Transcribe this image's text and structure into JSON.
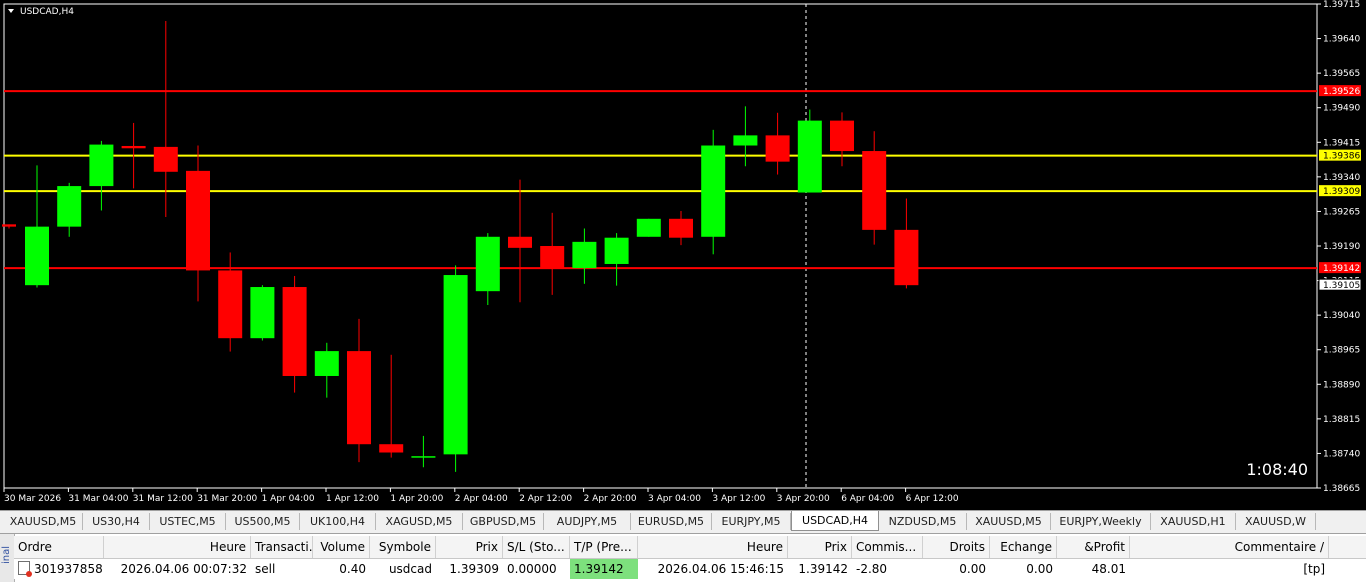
{
  "chart": {
    "title": "USDCAD,H4",
    "timer": "1:08:40",
    "colors": {
      "bull": "#00ff00",
      "bear": "#ff0000",
      "bg": "#000000",
      "grid_line": "#ffffff",
      "red_line": "#ff0000",
      "yellow_line": "#ffff00"
    },
    "price_ticks": [
      "1.39715",
      "1.39640",
      "1.39565",
      "1.39490",
      "1.39415",
      "1.39340",
      "1.39265",
      "1.39190",
      "1.39115",
      "1.39040",
      "1.38965",
      "1.38890",
      "1.38815",
      "1.38740",
      "1.38665"
    ],
    "time_labels": [
      "30 Mar 2026",
      "31 Mar 04:00",
      "31 Mar 12:00",
      "31 Mar 20:00",
      "1 Apr 04:00",
      "1 Apr 12:00",
      "1 Apr 20:00",
      "2 Apr 04:00",
      "2 Apr 12:00",
      "2 Apr 20:00",
      "3 Apr 04:00",
      "3 Apr 12:00",
      "3 Apr 20:00",
      "6 Apr 04:00",
      "6 Apr 12:00"
    ],
    "levels": [
      {
        "price": 1.39526,
        "label": "1.39526",
        "type": "red"
      },
      {
        "price": 1.39386,
        "label": "1.39386",
        "type": "yellow"
      },
      {
        "price": 1.39309,
        "label": "1.39309",
        "type": "yellow"
      },
      {
        "price": 1.39142,
        "label": "1.39142",
        "type": "red"
      }
    ],
    "current_price": {
      "price": 1.39105,
      "label": "1.39105"
    }
  },
  "chart_data": {
    "type": "candlestick",
    "symbol": "USDCAD",
    "timeframe": "H4",
    "ylim": [
      1.38665,
      1.39715
    ],
    "candles": [
      {
        "o": 1.39237,
        "h": 1.39237,
        "l": 1.39228,
        "c": 1.39232
      },
      {
        "o": 1.39105,
        "h": 1.39365,
        "l": 1.391,
        "c": 1.39232
      },
      {
        "o": 1.39232,
        "h": 1.39327,
        "l": 1.3921,
        "c": 1.3932
      },
      {
        "o": 1.3932,
        "h": 1.39418,
        "l": 1.39267,
        "c": 1.3941
      },
      {
        "o": 1.39407,
        "h": 1.39457,
        "l": 1.39315,
        "c": 1.39402
      },
      {
        "o": 1.39405,
        "h": 1.39678,
        "l": 1.39253,
        "c": 1.39351
      },
      {
        "o": 1.39353,
        "h": 1.39408,
        "l": 1.3907,
        "c": 1.39137
      },
      {
        "o": 1.39137,
        "h": 1.39176,
        "l": 1.38961,
        "c": 1.3899
      },
      {
        "o": 1.3899,
        "h": 1.39105,
        "l": 1.38985,
        "c": 1.39101
      },
      {
        "o": 1.39101,
        "h": 1.39125,
        "l": 1.38872,
        "c": 1.38908
      },
      {
        "o": 1.38908,
        "h": 1.3898,
        "l": 1.38861,
        "c": 1.38962
      },
      {
        "o": 1.38962,
        "h": 1.39032,
        "l": 1.38721,
        "c": 1.3876
      },
      {
        "o": 1.3876,
        "h": 1.38954,
        "l": 1.38731,
        "c": 1.38742
      },
      {
        "o": 1.38734,
        "h": 1.38778,
        "l": 1.3871,
        "c": 1.38734
      },
      {
        "o": 1.38738,
        "h": 1.39148,
        "l": 1.387,
        "c": 1.39127
      },
      {
        "o": 1.39092,
        "h": 1.39218,
        "l": 1.39062,
        "c": 1.3921
      },
      {
        "o": 1.3921,
        "h": 1.39334,
        "l": 1.39068,
        "c": 1.39186
      },
      {
        "o": 1.3919,
        "h": 1.39262,
        "l": 1.39084,
        "c": 1.3914
      },
      {
        "o": 1.39142,
        "h": 1.39228,
        "l": 1.39108,
        "c": 1.39199
      },
      {
        "o": 1.39151,
        "h": 1.39218,
        "l": 1.39104,
        "c": 1.39208
      },
      {
        "o": 1.3921,
        "h": 1.39249,
        "l": 1.3921,
        "c": 1.39249
      },
      {
        "o": 1.39249,
        "h": 1.39266,
        "l": 1.39192,
        "c": 1.39208
      },
      {
        "o": 1.3921,
        "h": 1.39442,
        "l": 1.39172,
        "c": 1.39408
      },
      {
        "o": 1.39408,
        "h": 1.39493,
        "l": 1.39363,
        "c": 1.3943
      },
      {
        "o": 1.3943,
        "h": 1.39479,
        "l": 1.39345,
        "c": 1.39373
      },
      {
        "o": 1.39306,
        "h": 1.39486,
        "l": 1.39306,
        "c": 1.39462
      },
      {
        "o": 1.39462,
        "h": 1.3948,
        "l": 1.39363,
        "c": 1.39396
      },
      {
        "o": 1.39396,
        "h": 1.39439,
        "l": 1.39193,
        "c": 1.39225
      },
      {
        "o": 1.39225,
        "h": 1.39293,
        "l": 1.39098,
        "c": 1.39105
      }
    ]
  },
  "tabs": [
    "XAUUSD,M5",
    "US30,H4",
    "USTEC,M5",
    "US500,M5",
    "UK100,H4",
    "XAGUSD,M5",
    "GBPUSD,M5",
    "AUDJPY,M5",
    "EURUSD,M5",
    "EURJPY,M5",
    "USDCAD,H4",
    "NZDUSD,M5",
    "XAUUSD,M5",
    "EURJPY,Weekly",
    "XAUUSD,H1",
    "XAUUSD,W"
  ],
  "active_tab": "USDCAD,H4",
  "terminal": {
    "side_label": "inal",
    "headers": [
      "Ordre",
      "Heure",
      "Transacti...",
      "Volume",
      "Symbole",
      "Prix",
      "S/L (Sto...",
      "T/P (Pre...",
      "Heure",
      "Prix",
      "Commis...",
      "Droits",
      "Echange",
      "&Profit",
      "Commentaire"
    ],
    "sort_marker": "/",
    "row": [
      "301937858",
      "2026.04.06 00:07:32",
      "sell",
      "0.40",
      "usdcad",
      "1.39309",
      "0.00000",
      "1.39142",
      "2026.04.06 15:46:15",
      "1.39142",
      "-2.80",
      "0.00",
      "0.00",
      "48.01",
      "[tp]"
    ]
  }
}
